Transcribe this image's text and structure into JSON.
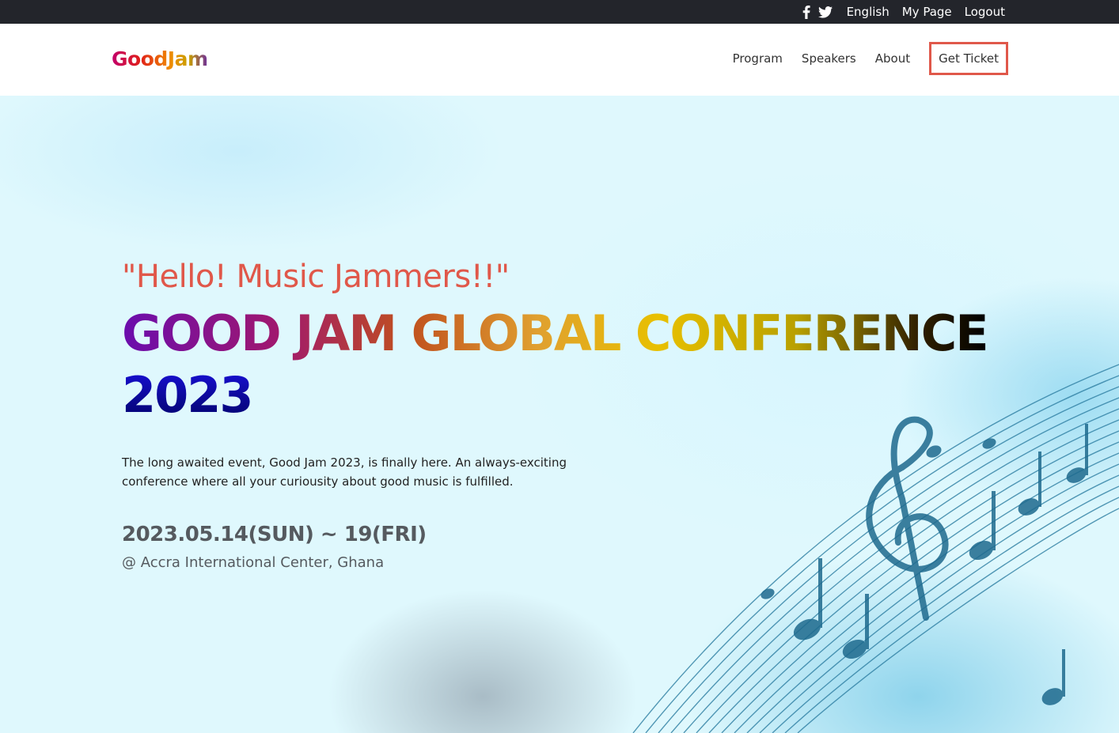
{
  "topbar": {
    "social": [
      "facebook-icon",
      "twitter-icon"
    ],
    "language": "English",
    "my_page": "My Page",
    "logout": "Logout"
  },
  "header": {
    "logo": "GoodJam",
    "nav": {
      "program": "Program",
      "speakers": "Speakers",
      "about": "About",
      "get_ticket": "Get Ticket"
    }
  },
  "hero": {
    "greeting": "\"Hello! Music Jammers!!\"",
    "title_line1": "GOOD JAM GLOBAL CONFERENCE",
    "title_line2": "2023",
    "description": "The long awaited event, Good Jam 2023, is finally here. An always-exciting conference where all your curiousity about good music is fulfilled.",
    "date": "2023.05.14(SUN) ~ 19(FRI)",
    "venue": "@ Accra International Center, Ghana"
  },
  "colors": {
    "topbar_bg": "#23252b",
    "accent": "#e0584a",
    "hero_bg": "#dff8fd"
  }
}
